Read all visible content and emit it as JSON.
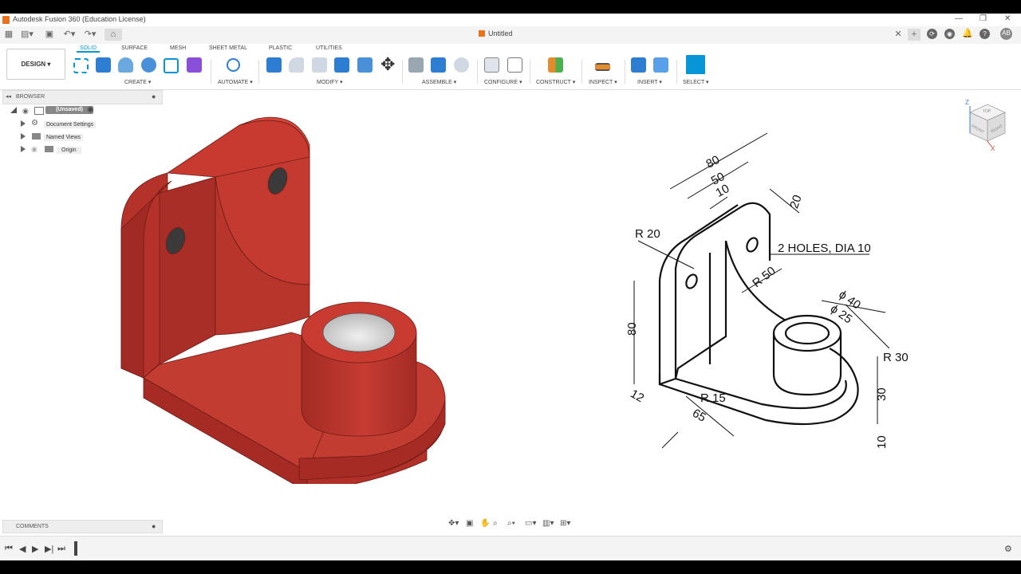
{
  "window": {
    "title": "Autodesk Fusion 360 (Education License)"
  },
  "document": {
    "tab_title": "Untitled",
    "user_initials": "AB"
  },
  "workspace": {
    "label": "DESIGN ▾"
  },
  "ribbon": {
    "tabs": [
      "SOLID",
      "SURFACE",
      "MESH",
      "SHEET METAL",
      "PLASTIC",
      "UTILITIES"
    ],
    "groups": [
      "CREATE ▾",
      "AUTOMATE ▾",
      "MODIFY ▾",
      "ASSEMBLE ▾",
      "CONFIGURE ▾",
      "CONSTRUCT ▾",
      "INSPECT ▾",
      "INSERT ▾",
      "SELECT ▾"
    ]
  },
  "browser": {
    "header": "BROWSER",
    "root": "(Unsaved)",
    "items": [
      "Document Settings",
      "Named Views",
      "Origin"
    ]
  },
  "comments": {
    "header": "COMMENTS"
  },
  "viewcube": {
    "face_top": "TOP",
    "face_front": "FRONT",
    "face_right": "RIGHT",
    "axis_z": "Z",
    "axis_x": "X"
  },
  "drawing": {
    "dims": {
      "d80_top": "80",
      "d50": "50",
      "d10_top": "10",
      "d20": "20",
      "r20": "R 20",
      "holes": "2 HOLES, DIA 10",
      "r50": "R 50",
      "dia40": "ϕ 40",
      "dia25": "ϕ 25",
      "d80_left": "80",
      "r30": "R 30",
      "d12": "12",
      "r15": "R 15",
      "d65": "65",
      "d30": "30",
      "d10_bottom": "10"
    }
  },
  "colors": {
    "model": "#b8352c",
    "accent": "#0696d7"
  }
}
